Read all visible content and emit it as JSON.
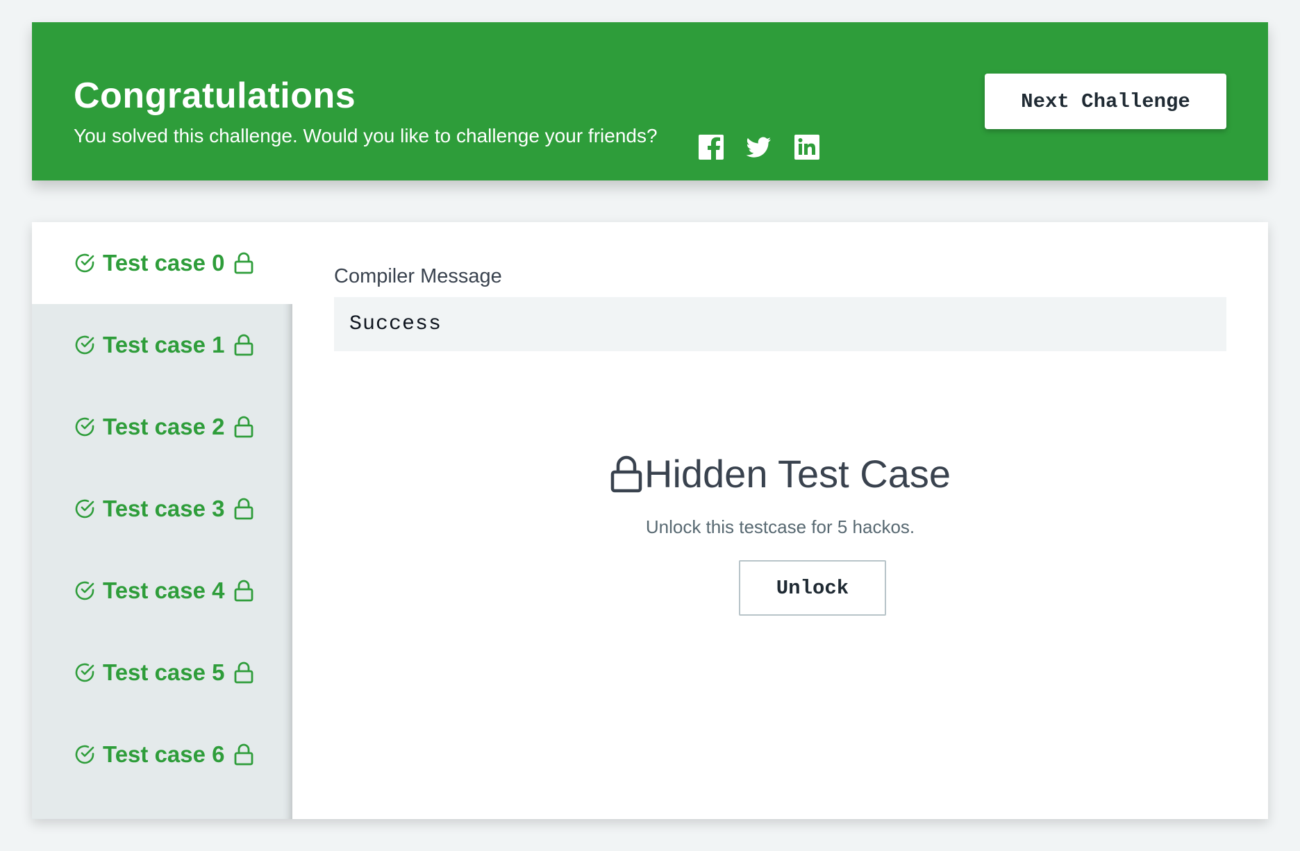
{
  "banner": {
    "title": "Congratulations",
    "subtitle": "You solved this challenge. Would you like to challenge your friends?",
    "social_icons": [
      "facebook-icon",
      "twitter-icon",
      "linkedin-icon"
    ],
    "next_button": "Next Challenge",
    "color": "#2e9d3a"
  },
  "tabs": [
    {
      "label": "Test case 0",
      "status": "passed",
      "locked": true,
      "active": true
    },
    {
      "label": "Test case 1",
      "status": "passed",
      "locked": true,
      "active": false
    },
    {
      "label": "Test case 2",
      "status": "passed",
      "locked": true,
      "active": false
    },
    {
      "label": "Test case 3",
      "status": "passed",
      "locked": true,
      "active": false
    },
    {
      "label": "Test case 4",
      "status": "passed",
      "locked": true,
      "active": false
    },
    {
      "label": "Test case 5",
      "status": "passed",
      "locked": true,
      "active": false
    },
    {
      "label": "Test case 6",
      "status": "passed",
      "locked": true,
      "active": false
    }
  ],
  "compiler": {
    "label": "Compiler Message",
    "message": "Success"
  },
  "hidden": {
    "title": "Hidden Test Case",
    "subtitle": "Unlock this testcase for 5 hackos.",
    "button": "Unlock"
  }
}
